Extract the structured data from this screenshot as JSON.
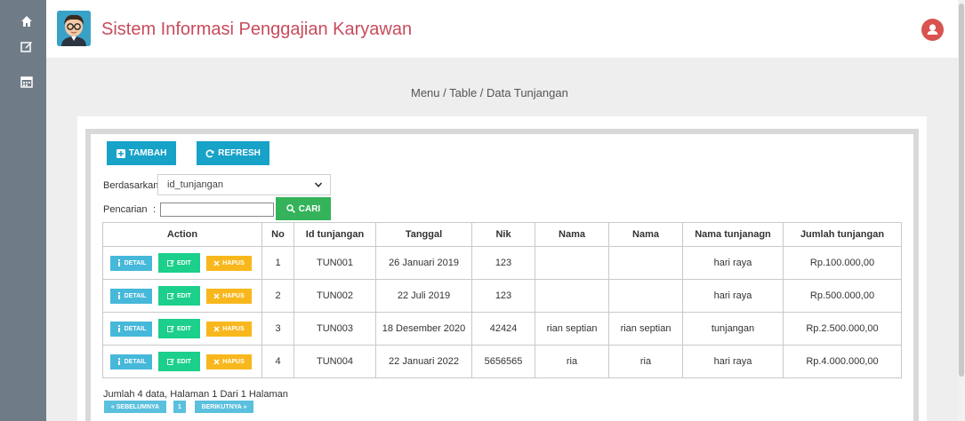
{
  "sidebar": {
    "icons": [
      "home-icon",
      "edit-icon",
      "calendar-icon"
    ]
  },
  "header": {
    "title": "Sistem Informasi Penggajian Karyawan"
  },
  "breadcrumb": "Menu / Table / Data Tunjangan",
  "toolbar": {
    "tambah_label": "TAMBAH",
    "refresh_label": "REFRESH"
  },
  "filter": {
    "by_label": "Berdasarkan:",
    "by_value": "id_tunjangan",
    "search_label": "Pencarian",
    "search_colon": ":",
    "search_value": "",
    "cari_label": "CARI"
  },
  "table": {
    "headers": [
      "Action",
      "No",
      "Id tunjangan",
      "Tanggal",
      "Nik",
      "Nama",
      "Nama",
      "Nama tunjanagn",
      "Jumlah tunjangan"
    ],
    "action_labels": {
      "detail": "DETAIL",
      "edit": "EDIT",
      "hapus": "HAPUS"
    },
    "rows": [
      {
        "no": "1",
        "id": "TUN001",
        "tanggal": "26 Januari 2019",
        "nik": "123",
        "nama1": "",
        "nama2": "",
        "nama_tunjangan": "hari raya",
        "jumlah": "Rp.100.000,00"
      },
      {
        "no": "2",
        "id": "TUN002",
        "tanggal": "22 Juli 2019",
        "nik": "123",
        "nama1": "",
        "nama2": "",
        "nama_tunjangan": "hari raya",
        "jumlah": "Rp.500.000,00"
      },
      {
        "no": "3",
        "id": "TUN003",
        "tanggal": "18 Desember 2020",
        "nik": "42424",
        "nama1": "rian septian",
        "nama2": "rian septian",
        "nama_tunjangan": "tunjangan",
        "jumlah": "Rp.2.500.000,00"
      },
      {
        "no": "4",
        "id": "TUN004",
        "tanggal": "22 Januari 2022",
        "nik": "5656565",
        "nama1": "ria",
        "nama2": "ria",
        "nama_tunjangan": "hari raya",
        "jumlah": "Rp.4.000.000,00"
      }
    ]
  },
  "footer": {
    "summary": "Jumlah 4 data, Halaman 1 Dari 1 Halaman",
    "prev_label": "« SEBELUMNYA",
    "page_label": "1",
    "next_label": "BERIKUTNYA »"
  },
  "colors": {
    "title": "#c84b5c",
    "sidebar": "#6f7c87",
    "primary": "#17a2c8",
    "success": "#35b35a",
    "edit": "#1ccf8a",
    "warning": "#f8b81d",
    "info": "#46b8da"
  }
}
